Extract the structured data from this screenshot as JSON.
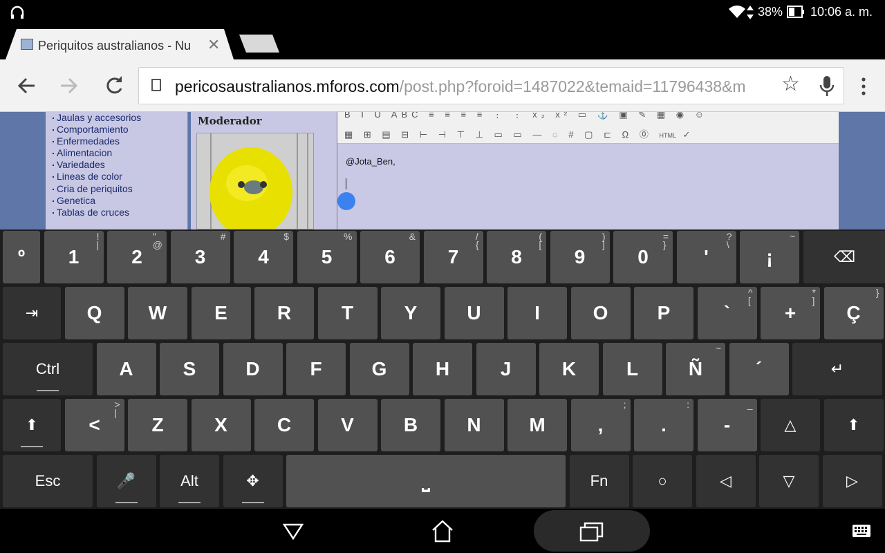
{
  "status_bar": {
    "battery": "38%",
    "time": "10:06 a. m.",
    "icons": [
      "headset-icon",
      "wifi-icon",
      "data-arrows-icon",
      "battery-icon"
    ]
  },
  "tab": {
    "title": "Periquitos australianos - Nu"
  },
  "toolbar": {
    "url_host": "pericosaustralianos.mforos.com",
    "url_path": "/post.php?foroid=1487022&temaid=11796438&m"
  },
  "forum": {
    "nav_items": [
      "Jaulas y accesorios",
      "Comportamiento",
      "Enfermedades",
      "Alimentacion",
      "Variedades",
      "Lineas de color",
      "Cria de periquitos",
      "Genetica",
      "Tablas de cruces"
    ],
    "user_rank": "Moderador",
    "editor_text": "@Jota_Ben,",
    "editor_html_btn": "HTML"
  },
  "keyboard": {
    "rows": [
      [
        {
          "id": "key-ordinal",
          "main": "º",
          "sub": "",
          "w": 54,
          "fn": false
        },
        {
          "id": "key-1",
          "main": "1",
          "sub": "!\n|",
          "w": 86,
          "fn": false
        },
        {
          "id": "key-2",
          "main": "2",
          "sub": "\"\n@",
          "w": 86,
          "fn": false
        },
        {
          "id": "key-3",
          "main": "3",
          "sub": "#",
          "w": 86,
          "fn": false
        },
        {
          "id": "key-4",
          "main": "4",
          "sub": "$",
          "w": 86,
          "fn": false
        },
        {
          "id": "key-5",
          "main": "5",
          "sub": "%",
          "w": 86,
          "fn": false
        },
        {
          "id": "key-6",
          "main": "6",
          "sub": "&",
          "w": 86,
          "fn": false
        },
        {
          "id": "key-7",
          "main": "7",
          "sub": "/\n{",
          "w": 86,
          "fn": false
        },
        {
          "id": "key-8",
          "main": "8",
          "sub": "(\n[",
          "w": 86,
          "fn": false
        },
        {
          "id": "key-9",
          "main": "9",
          "sub": ")\n]",
          "w": 86,
          "fn": false
        },
        {
          "id": "key-0",
          "main": "0",
          "sub": "=\n}",
          "w": 86,
          "fn": false
        },
        {
          "id": "key-apostrophe",
          "main": "'",
          "sub": "?\n\\",
          "w": 86,
          "fn": false
        },
        {
          "id": "key-inverted-exclamation",
          "main": "¡",
          "sub": "~",
          "w": 86,
          "fn": false
        },
        {
          "id": "key-backspace",
          "main": "⌫",
          "sub": "",
          "w": 120,
          "fn": true
        }
      ],
      [
        {
          "id": "key-tab",
          "main": "⇥",
          "sub": "",
          "w": 84,
          "fn": true
        },
        {
          "id": "key-q",
          "main": "Q",
          "sub": "",
          "w": 86,
          "fn": false
        },
        {
          "id": "key-w",
          "main": "W",
          "sub": "",
          "w": 86,
          "fn": false
        },
        {
          "id": "key-e",
          "main": "E",
          "sub": "",
          "w": 86,
          "fn": false
        },
        {
          "id": "key-r",
          "main": "R",
          "sub": "",
          "w": 86,
          "fn": false
        },
        {
          "id": "key-t",
          "main": "T",
          "sub": "",
          "w": 86,
          "fn": false
        },
        {
          "id": "key-y",
          "main": "Y",
          "sub": "",
          "w": 86,
          "fn": false
        },
        {
          "id": "key-u",
          "main": "U",
          "sub": "",
          "w": 86,
          "fn": false
        },
        {
          "id": "key-i",
          "main": "I",
          "sub": "",
          "w": 86,
          "fn": false
        },
        {
          "id": "key-o",
          "main": "O",
          "sub": "",
          "w": 86,
          "fn": false
        },
        {
          "id": "key-p",
          "main": "P",
          "sub": "",
          "w": 86,
          "fn": false
        },
        {
          "id": "key-grave",
          "main": "`",
          "sub": "^\n[",
          "w": 86,
          "fn": false
        },
        {
          "id": "key-plus",
          "main": "+",
          "sub": "*\n]",
          "w": 86,
          "fn": false
        },
        {
          "id": "key-c-cedilla",
          "main": "Ç",
          "sub": "}",
          "w": 86,
          "fn": false
        }
      ],
      [
        {
          "id": "key-ctrl",
          "main": "Ctrl",
          "sub": "",
          "w": 130,
          "fn": true
        },
        {
          "id": "key-a",
          "main": "A",
          "sub": "",
          "w": 86,
          "fn": false
        },
        {
          "id": "key-s",
          "main": "S",
          "sub": "",
          "w": 86,
          "fn": false
        },
        {
          "id": "key-d",
          "main": "D",
          "sub": "",
          "w": 86,
          "fn": false
        },
        {
          "id": "key-f",
          "main": "F",
          "sub": "",
          "w": 86,
          "fn": false
        },
        {
          "id": "key-g",
          "main": "G",
          "sub": "",
          "w": 86,
          "fn": false
        },
        {
          "id": "key-h",
          "main": "H",
          "sub": "",
          "w": 86,
          "fn": false
        },
        {
          "id": "key-j",
          "main": "J",
          "sub": "",
          "w": 86,
          "fn": false
        },
        {
          "id": "key-k",
          "main": "K",
          "sub": "",
          "w": 86,
          "fn": false
        },
        {
          "id": "key-l",
          "main": "L",
          "sub": "",
          "w": 86,
          "fn": false
        },
        {
          "id": "key-n-tilde",
          "main": "Ñ",
          "sub": "~",
          "w": 86,
          "fn": false
        },
        {
          "id": "key-acute",
          "main": "´",
          "sub": "",
          "w": 86,
          "fn": false
        },
        {
          "id": "key-enter",
          "main": "↵",
          "sub": "",
          "w": 130,
          "fn": true
        }
      ],
      [
        {
          "id": "key-shift-left",
          "main": "⬆",
          "sub": "",
          "w": 84,
          "fn": true
        },
        {
          "id": "key-less-than",
          "main": "<",
          "sub": ">\n|",
          "w": 86,
          "fn": false
        },
        {
          "id": "key-z",
          "main": "Z",
          "sub": "",
          "w": 86,
          "fn": false
        },
        {
          "id": "key-x",
          "main": "X",
          "sub": "",
          "w": 86,
          "fn": false
        },
        {
          "id": "key-c",
          "main": "C",
          "sub": "",
          "w": 86,
          "fn": false
        },
        {
          "id": "key-v",
          "main": "V",
          "sub": "",
          "w": 86,
          "fn": false
        },
        {
          "id": "key-b",
          "main": "B",
          "sub": "",
          "w": 86,
          "fn": false
        },
        {
          "id": "key-n",
          "main": "N",
          "sub": "",
          "w": 86,
          "fn": false
        },
        {
          "id": "key-m",
          "main": "M",
          "sub": "",
          "w": 86,
          "fn": false
        },
        {
          "id": "key-comma",
          "main": ",",
          "sub": ";",
          "w": 86,
          "fn": false
        },
        {
          "id": "key-period",
          "main": ".",
          "sub": ":",
          "w": 86,
          "fn": false
        },
        {
          "id": "key-minus",
          "main": "-",
          "sub": "_",
          "w": 86,
          "fn": false
        },
        {
          "id": "key-up-arrow",
          "main": "△",
          "sub": "",
          "w": 86,
          "fn": true
        },
        {
          "id": "key-shift-right",
          "main": "⬆",
          "sub": "",
          "w": 86,
          "fn": true
        }
      ],
      [
        {
          "id": "key-esc",
          "main": "Esc",
          "sub": "",
          "w": 130,
          "fn": true
        },
        {
          "id": "key-voice",
          "main": "🎤",
          "sub": "",
          "w": 86,
          "fn": true
        },
        {
          "id": "key-alt",
          "main": "Alt",
          "sub": "",
          "w": 86,
          "fn": true
        },
        {
          "id": "key-settings",
          "main": "✥",
          "sub": "",
          "w": 86,
          "fn": true
        },
        {
          "id": "key-space",
          "main": "⎵",
          "sub": "",
          "w": 404,
          "fn": false
        },
        {
          "id": "key-fn",
          "main": "Fn",
          "sub": "",
          "w": 86,
          "fn": true
        },
        {
          "id": "key-home",
          "main": "○",
          "sub": "",
          "w": 86,
          "fn": true
        },
        {
          "id": "key-left-arrow",
          "main": "◁",
          "sub": "",
          "w": 86,
          "fn": true
        },
        {
          "id": "key-down-arrow",
          "main": "▽",
          "sub": "",
          "w": 86,
          "fn": true
        },
        {
          "id": "key-right-arrow",
          "main": "▷",
          "sub": "",
          "w": 86,
          "fn": true
        }
      ]
    ]
  }
}
